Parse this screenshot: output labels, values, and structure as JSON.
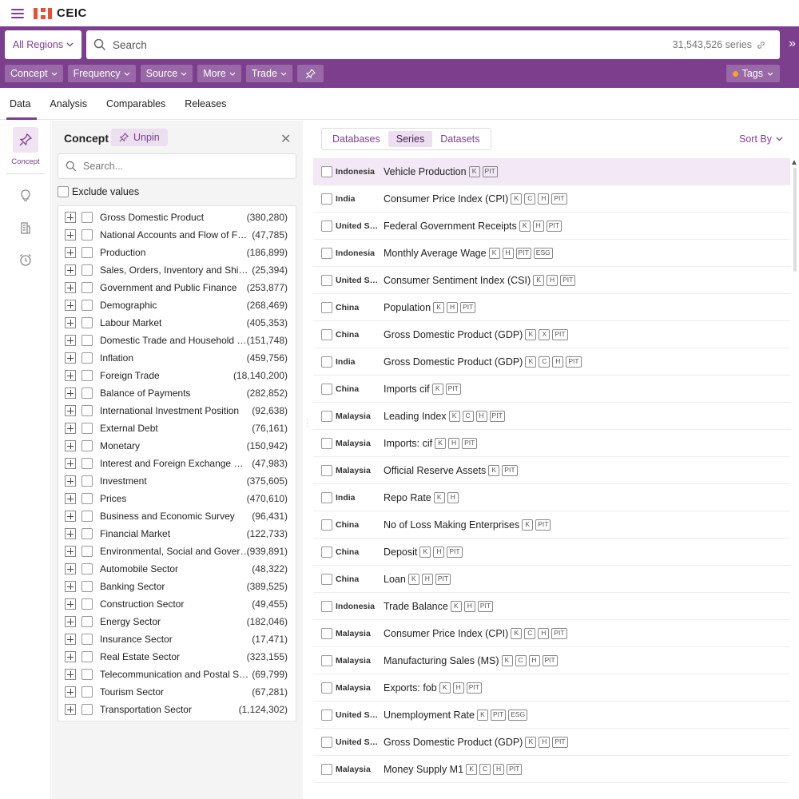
{
  "app": {
    "brand": "CEIC"
  },
  "search": {
    "region_label": "All Regions",
    "placeholder": "Search",
    "series_count": "31,543,526 series"
  },
  "filters": [
    "Concept",
    "Frequency",
    "Source",
    "More",
    "Trade"
  ],
  "tags_label": "Tags",
  "tabs": [
    "Data",
    "Analysis",
    "Comparables",
    "Releases"
  ],
  "rail": {
    "concept_label": "Concept"
  },
  "concept_panel": {
    "title": "Concept",
    "unpin_label": "Unpin",
    "search_placeholder": "Search...",
    "exclude_label": "Exclude values",
    "items": [
      {
        "label": "Gross Domestic Product",
        "count": "(380,280)"
      },
      {
        "label": "National Accounts and Flow of Funds",
        "count": "(47,785)"
      },
      {
        "label": "Production",
        "count": "(186,899)"
      },
      {
        "label": "Sales, Orders, Inventory and Shipments",
        "count": "(25,394)"
      },
      {
        "label": "Government and Public Finance",
        "count": "(253,877)"
      },
      {
        "label": "Demographic",
        "count": "(268,469)"
      },
      {
        "label": "Labour Market",
        "count": "(405,353)"
      },
      {
        "label": "Domestic Trade and Household Surveys",
        "count": "(151,748)"
      },
      {
        "label": "Inflation",
        "count": "(459,756)"
      },
      {
        "label": "Foreign Trade",
        "count": "(18,140,200)"
      },
      {
        "label": "Balance of Payments",
        "count": "(282,852)"
      },
      {
        "label": "International Investment Position",
        "count": "(92,638)"
      },
      {
        "label": "External Debt",
        "count": "(76,161)"
      },
      {
        "label": "Monetary",
        "count": "(150,942)"
      },
      {
        "label": "Interest and Foreign Exchange Rate",
        "count": "(47,983)"
      },
      {
        "label": "Investment",
        "count": "(375,605)"
      },
      {
        "label": "Prices",
        "count": "(470,610)"
      },
      {
        "label": "Business and Economic Survey",
        "count": "(96,431)"
      },
      {
        "label": "Financial Market",
        "count": "(122,733)"
      },
      {
        "label": "Environmental, Social and Governance",
        "count": "(939,891)"
      },
      {
        "label": "Automobile Sector",
        "count": "(48,322)"
      },
      {
        "label": "Banking Sector",
        "count": "(389,525)"
      },
      {
        "label": "Construction Sector",
        "count": "(49,455)"
      },
      {
        "label": "Energy Sector",
        "count": "(182,046)"
      },
      {
        "label": "Insurance Sector",
        "count": "(17,471)"
      },
      {
        "label": "Real Estate Sector",
        "count": "(323,155)"
      },
      {
        "label": "Telecommunication and Postal Sector",
        "count": "(69,799)"
      },
      {
        "label": "Tourism Sector",
        "count": "(67,281)"
      },
      {
        "label": "Transportation Sector",
        "count": "(1,124,302)"
      }
    ]
  },
  "results": {
    "segments": [
      "Databases",
      "Series",
      "Datasets"
    ],
    "active_segment": "Series",
    "sort_label": "Sort By",
    "rows": [
      {
        "region": "Indonesia",
        "name": "Vehicle Production",
        "badges": [
          "K",
          "PIT"
        ]
      },
      {
        "region": "India",
        "name": "Consumer Price Index (CPI)",
        "badges": [
          "K",
          "C",
          "H",
          "PIT"
        ]
      },
      {
        "region": "United States",
        "name": "Federal Government Receipts",
        "badges": [
          "K",
          "H",
          "PIT"
        ]
      },
      {
        "region": "Indonesia",
        "name": "Monthly Average Wage",
        "badges": [
          "K",
          "H",
          "PIT",
          "ESG"
        ]
      },
      {
        "region": "United States",
        "name": "Consumer Sentiment Index (CSI)",
        "badges": [
          "K",
          "H",
          "PIT"
        ]
      },
      {
        "region": "China",
        "name": "Population",
        "badges": [
          "K",
          "H",
          "PIT"
        ]
      },
      {
        "region": "China",
        "name": "Gross Domestic Product (GDP)",
        "badges": [
          "K",
          "X",
          "PIT"
        ]
      },
      {
        "region": "India",
        "name": "Gross Domestic Product (GDP)",
        "badges": [
          "K",
          "C",
          "H",
          "PIT"
        ]
      },
      {
        "region": "China",
        "name": "Imports cif",
        "badges": [
          "K",
          "PIT"
        ]
      },
      {
        "region": "Malaysia",
        "name": "Leading Index",
        "badges": [
          "K",
          "C",
          "H",
          "PIT"
        ]
      },
      {
        "region": "Malaysia",
        "name": "Imports: cif",
        "badges": [
          "K",
          "H",
          "PIT"
        ]
      },
      {
        "region": "Malaysia",
        "name": "Official Reserve Assets",
        "badges": [
          "K",
          "PIT"
        ]
      },
      {
        "region": "India",
        "name": "Repo Rate",
        "badges": [
          "K",
          "H"
        ]
      },
      {
        "region": "China",
        "name": "No of Loss Making Enterprises",
        "badges": [
          "K",
          "PIT"
        ]
      },
      {
        "region": "China",
        "name": "Deposit",
        "badges": [
          "K",
          "H",
          "PIT"
        ]
      },
      {
        "region": "China",
        "name": "Loan",
        "badges": [
          "K",
          "H",
          "PIT"
        ]
      },
      {
        "region": "Indonesia",
        "name": "Trade Balance",
        "badges": [
          "K",
          "H",
          "PIT"
        ]
      },
      {
        "region": "Malaysia",
        "name": "Consumer Price Index (CPI)",
        "badges": [
          "K",
          "C",
          "H",
          "PIT"
        ]
      },
      {
        "region": "Malaysia",
        "name": "Manufacturing Sales (MS)",
        "badges": [
          "K",
          "C",
          "H",
          "PIT"
        ]
      },
      {
        "region": "Malaysia",
        "name": "Exports: fob",
        "badges": [
          "K",
          "H",
          "PIT"
        ]
      },
      {
        "region": "United States",
        "name": "Unemployment Rate",
        "badges": [
          "K",
          "PIT",
          "ESG"
        ]
      },
      {
        "region": "United States",
        "name": "Gross Domestic Product (GDP)",
        "badges": [
          "K",
          "H",
          "PIT"
        ]
      },
      {
        "region": "Malaysia",
        "name": "Money Supply M1",
        "badges": [
          "K",
          "C",
          "H",
          "PIT"
        ]
      }
    ]
  },
  "colors": {
    "brand_purple": "#7c3f8e",
    "logo_orange": "#e8502f",
    "tag_dot": "#f5a623"
  }
}
